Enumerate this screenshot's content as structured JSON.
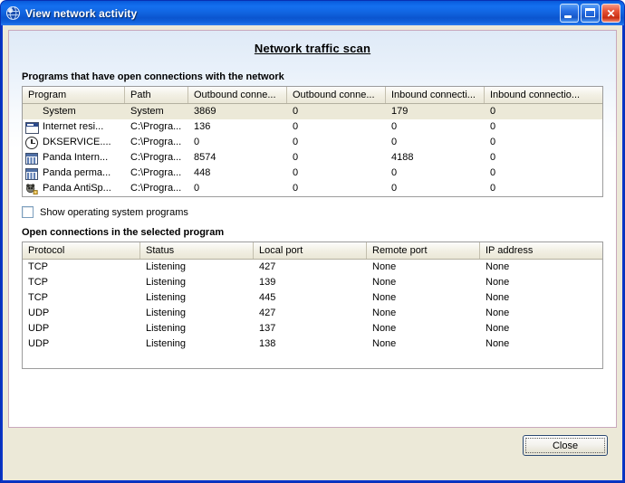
{
  "window": {
    "title": "View network activity",
    "icon": "network-globe-icon",
    "controls": {
      "minimize": "Minimize",
      "maximize": "Maximize",
      "close": "Close"
    }
  },
  "page": {
    "heading": "Network traffic scan",
    "programs_label": "Programs that have open connections with the network",
    "connections_label": "Open connections in the selected program"
  },
  "programs_table": {
    "columns": [
      "Program",
      "Path",
      "Outbound conne...",
      "Outbound conne...",
      "Inbound connecti...",
      "Inbound connectio..."
    ],
    "rows": [
      {
        "icon": "none",
        "program": "System",
        "path": "System",
        "outbound_a": "3869",
        "outbound_b": "0",
        "inbound_a": "179",
        "inbound_b": "0",
        "selected": true
      },
      {
        "icon": "window-icon",
        "program": "Internet resi...",
        "path": "C:\\Progra...",
        "outbound_a": "136",
        "outbound_b": "0",
        "inbound_a": "0",
        "inbound_b": "0",
        "selected": false
      },
      {
        "icon": "clock-icon",
        "program": "DKSERVICE....",
        "path": "C:\\Progra...",
        "outbound_a": "0",
        "outbound_b": "0",
        "inbound_a": "0",
        "inbound_b": "0",
        "selected": false
      },
      {
        "icon": "grid-icon",
        "program": "Panda Intern...",
        "path": "C:\\Progra...",
        "outbound_a": "8574",
        "outbound_b": "0",
        "inbound_a": "4188",
        "inbound_b": "0",
        "selected": false
      },
      {
        "icon": "grid-icon",
        "program": "Panda perma...",
        "path": "C:\\Progra...",
        "outbound_a": "448",
        "outbound_b": "0",
        "inbound_a": "0",
        "inbound_b": "0",
        "selected": false
      },
      {
        "icon": "panda-icon",
        "program": "Panda AntiSp...",
        "path": "C:\\Progra...",
        "outbound_a": "0",
        "outbound_b": "0",
        "inbound_a": "0",
        "inbound_b": "0",
        "selected": false
      }
    ]
  },
  "show_os_programs": {
    "label": "Show operating system programs",
    "checked": false
  },
  "connections_table": {
    "columns": [
      "Protocol",
      "Status",
      "Local port",
      "Remote port",
      "IP address"
    ],
    "rows": [
      {
        "protocol": "TCP",
        "status": "Listening",
        "local_port": "427",
        "remote_port": "None",
        "ip_address": "None"
      },
      {
        "protocol": "TCP",
        "status": "Listening",
        "local_port": "139",
        "remote_port": "None",
        "ip_address": "None"
      },
      {
        "protocol": "TCP",
        "status": "Listening",
        "local_port": "445",
        "remote_port": "None",
        "ip_address": "None"
      },
      {
        "protocol": "UDP",
        "status": "Listening",
        "local_port": "427",
        "remote_port": "None",
        "ip_address": "None"
      },
      {
        "protocol": "UDP",
        "status": "Listening",
        "local_port": "137",
        "remote_port": "None",
        "ip_address": "None"
      },
      {
        "protocol": "UDP",
        "status": "Listening",
        "local_port": "138",
        "remote_port": "None",
        "ip_address": "None"
      }
    ]
  },
  "footer": {
    "close_label": "Close"
  },
  "colors": {
    "titlebar_blue": "#0c63e4",
    "client_beige": "#ece9d8",
    "selection": "#ece9d8",
    "panel_border": "#c9a8bc",
    "close_red": "#c92e12"
  }
}
